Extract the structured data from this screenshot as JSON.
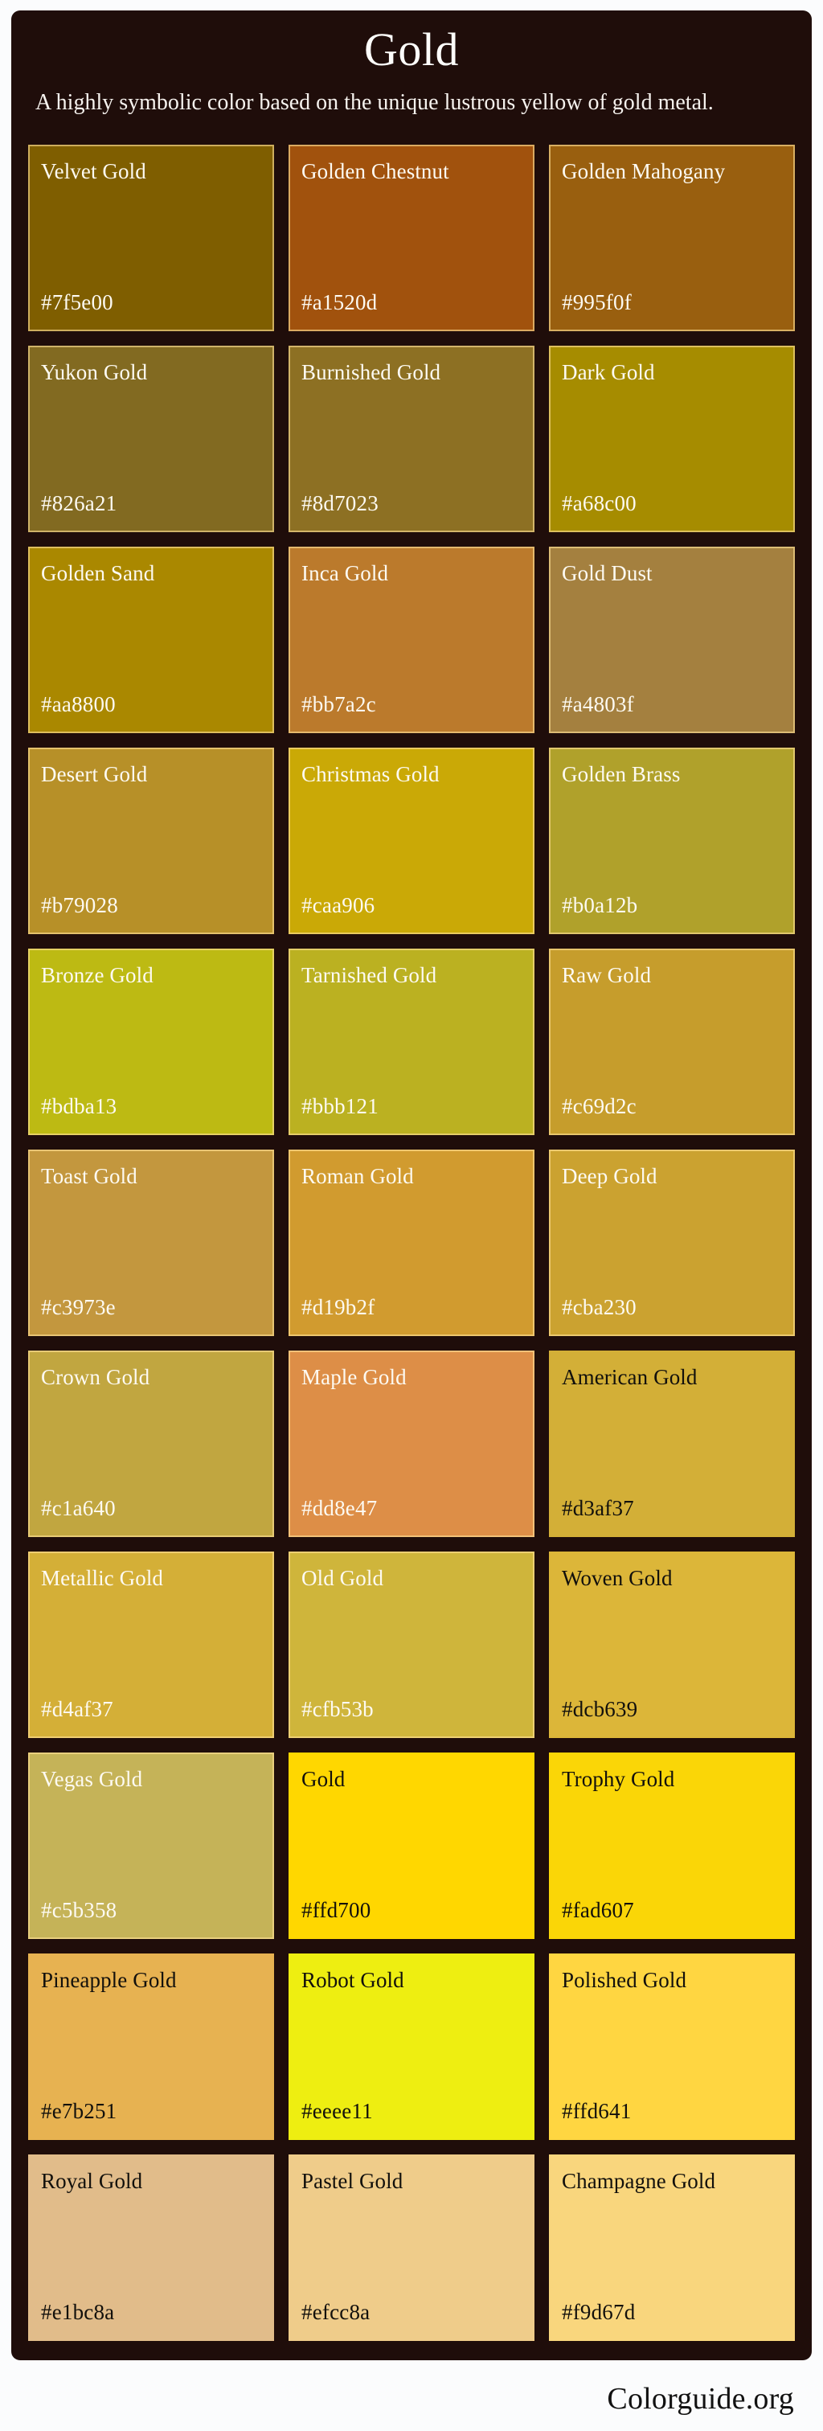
{
  "header": {
    "title": "Gold",
    "description": "A highly symbolic color based on the unique lustrous yellow of gold metal.",
    "watermark": "Colorguide.org"
  },
  "footer": {
    "brand": "Colorguide.org"
  },
  "panel": {
    "background": "#1f0d0a",
    "border_color": "#ffe196"
  },
  "chart_data": {
    "type": "table",
    "title": "Gold",
    "subtitle": "A highly symbolic color based on the unique lustrous yellow of gold metal.",
    "columns": [
      "name",
      "hex"
    ],
    "columns_count": 3,
    "rows_count": 11,
    "swatches": [
      {
        "name": "Velvet Gold",
        "hex": "#7f5e00",
        "text": "light",
        "bordered": true
      },
      {
        "name": "Golden Chestnut",
        "hex": "#a1520d",
        "text": "light",
        "bordered": true
      },
      {
        "name": "Golden Mahogany",
        "hex": "#995f0f",
        "text": "light",
        "bordered": true
      },
      {
        "name": "Yukon Gold",
        "hex": "#826a21",
        "text": "light",
        "bordered": true
      },
      {
        "name": "Burnished Gold",
        "hex": "#8d7023",
        "text": "light",
        "bordered": true
      },
      {
        "name": "Dark Gold",
        "hex": "#a68c00",
        "text": "light",
        "bordered": true
      },
      {
        "name": "Golden Sand",
        "hex": "#aa8800",
        "text": "light",
        "bordered": true
      },
      {
        "name": "Inca Gold",
        "hex": "#bb7a2c",
        "text": "light",
        "bordered": true
      },
      {
        "name": "Gold Dust",
        "hex": "#a4803f",
        "text": "light",
        "bordered": true
      },
      {
        "name": "Desert Gold",
        "hex": "#b79028",
        "text": "light",
        "bordered": true
      },
      {
        "name": "Christmas Gold",
        "hex": "#caa906",
        "text": "light",
        "bordered": true
      },
      {
        "name": "Golden Brass",
        "hex": "#b0a12b",
        "text": "light",
        "bordered": true
      },
      {
        "name": "Bronze Gold",
        "hex": "#bdba13",
        "text": "light",
        "bordered": true
      },
      {
        "name": "Tarnished Gold",
        "hex": "#bbb121",
        "text": "light",
        "bordered": true
      },
      {
        "name": "Raw Gold",
        "hex": "#c69d2c",
        "text": "light",
        "bordered": true
      },
      {
        "name": "Toast Gold",
        "hex": "#c3973e",
        "text": "light",
        "bordered": true
      },
      {
        "name": "Roman Gold",
        "hex": "#d19b2f",
        "text": "light",
        "bordered": true
      },
      {
        "name": "Deep Gold",
        "hex": "#cba230",
        "text": "light",
        "bordered": true
      },
      {
        "name": "Crown Gold",
        "hex": "#c1a640",
        "text": "light",
        "bordered": true
      },
      {
        "name": "Maple Gold",
        "hex": "#dd8e47",
        "text": "light",
        "bordered": true
      },
      {
        "name": "American Gold",
        "hex": "#d3af37",
        "text": "dark",
        "bordered": false
      },
      {
        "name": "Metallic Gold",
        "hex": "#d4af37",
        "text": "light",
        "bordered": true
      },
      {
        "name": "Old Gold",
        "hex": "#cfb53b",
        "text": "light",
        "bordered": true
      },
      {
        "name": "Woven Gold",
        "hex": "#dcb639",
        "text": "dark",
        "bordered": false
      },
      {
        "name": "Vegas Gold",
        "hex": "#c5b358",
        "text": "light",
        "bordered": true
      },
      {
        "name": "Gold",
        "hex": "#ffd700",
        "text": "dark",
        "bordered": false
      },
      {
        "name": "Trophy Gold",
        "hex": "#fad607",
        "text": "dark",
        "bordered": false
      },
      {
        "name": "Pineapple Gold",
        "hex": "#e7b251",
        "text": "dark",
        "bordered": false
      },
      {
        "name": "Robot Gold",
        "hex": "#eeee11",
        "text": "dark",
        "bordered": false
      },
      {
        "name": "Polished Gold",
        "hex": "#ffd641",
        "text": "dark",
        "bordered": false
      },
      {
        "name": "Royal Gold",
        "hex": "#e1bc8a",
        "text": "dark",
        "bordered": false
      },
      {
        "name": "Pastel Gold",
        "hex": "#efcc8a",
        "text": "dark",
        "bordered": false
      },
      {
        "name": "Champagne Gold",
        "hex": "#f9d67d",
        "text": "dark",
        "bordered": false
      }
    ]
  }
}
